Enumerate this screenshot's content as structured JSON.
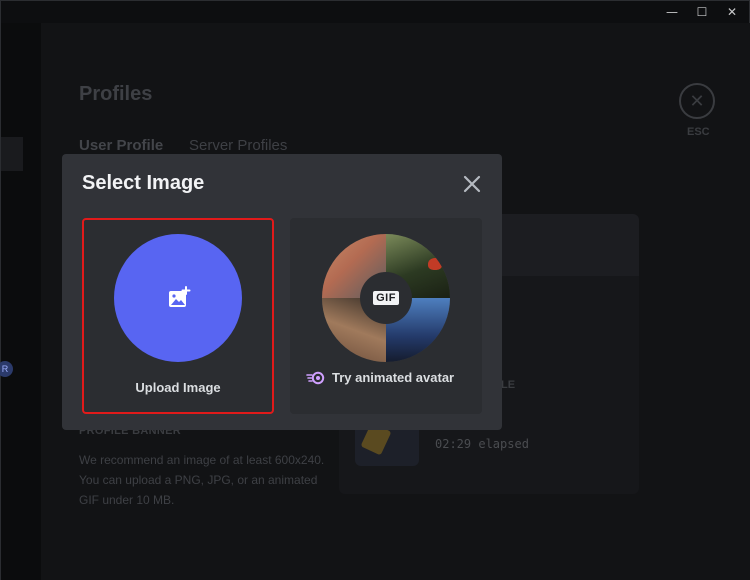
{
  "window": {
    "minimize_glyph": "—",
    "maximize_glyph": "☐",
    "close_glyph": "✕"
  },
  "background": {
    "title": "Profiles",
    "tabs": [
      "User Profile",
      "Server Profiles"
    ],
    "esc_label": "ESC",
    "activity_label": "LE",
    "activity_mid": "E",
    "elapsed": "02:29 elapsed",
    "banner_heading": "PROFILE BANNER",
    "banner_desc": "We recommend an image of at least 600x240. You can upload a PNG, JPG, or an animated GIF under 10 MB."
  },
  "modal": {
    "title": "Select Image",
    "upload_label": "Upload Image",
    "gif_badge": "GIF",
    "gif_label": "Try animated avatar"
  },
  "colors": {
    "accent": "#5865f2",
    "highlight_border": "#e11a1a",
    "modal_bg": "#313338",
    "tile_bg": "#2b2d31"
  },
  "icons": {
    "upload": "image-plus-icon",
    "close": "close-icon",
    "esc": "esc-close-icon",
    "nitro": "nitro-icon"
  }
}
